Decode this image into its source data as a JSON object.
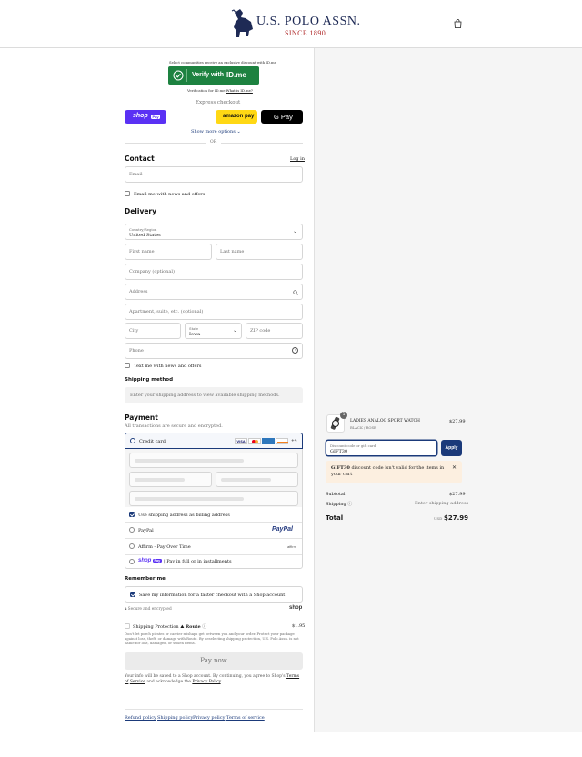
{
  "header": {
    "brand": "U.S. POLO ASSN.",
    "since": "SINCE 1890",
    "cart_icon": "shopping-bag-icon"
  },
  "idme": {
    "promo": "Select communities receive an exclusive discount with ID.me",
    "button_label": "Verify with",
    "button_brand": "ID.me",
    "footnote": "Verification for ID.me",
    "footnote_link": "What is ID.me?"
  },
  "express": {
    "title": "Express checkout",
    "shop_pay": "shop",
    "shop_pay_badge": "Pay",
    "amazon_pay": "amazon pay",
    "google_pay": "G Pay",
    "show_more": "Show more options",
    "or": "OR"
  },
  "contact": {
    "title": "Contact",
    "login": "Log in",
    "email_placeholder": "Email",
    "news_label": "Email me with news and offers"
  },
  "delivery": {
    "title": "Delivery",
    "country_label": "Country/Region",
    "country_value": "United States",
    "first_name": "First name",
    "last_name": "Last name",
    "company": "Company (optional)",
    "address": "Address",
    "apartment": "Apartment, suite, etc. (optional)",
    "city": "City",
    "state_label": "State",
    "state_value": "Iowa",
    "zip": "ZIP code",
    "phone": "Phone",
    "text_label": "Text me with news and offers"
  },
  "shipping": {
    "title": "Shipping method",
    "placeholder": "Enter your shipping address to view available shipping methods."
  },
  "payment": {
    "title": "Payment",
    "subtitle": "All transactions are secure and encrypted.",
    "credit_card": "Credit card",
    "cards": [
      "VISA",
      "MC",
      "AMEX",
      "DISCOVER"
    ],
    "more_cards": "+4",
    "billing_label": "Use shipping address as billing address",
    "paypal": "PayPal",
    "paypal_logo": "PayPal",
    "affirm": "Affirm - Pay Over Time",
    "affirm_logo": "affirm",
    "shoppay_badge": "shop",
    "shoppay_badge_pay": "Pay",
    "shoppay_text": "| Pay in full or in installments"
  },
  "remember": {
    "title": "Remember me",
    "save_label": "Save my information for a faster checkout with a Shop account",
    "secure": "Secure and encrypted",
    "shop_logo": "shop"
  },
  "protection": {
    "label": "Shipping Protection",
    "route": "Route",
    "price": "$1.95",
    "desc_line1": "Don't let porch pirates or carrier mishaps get between you and your order. Protect your package",
    "desc_line2": "against loss, theft, or damage with Route. By deselecting shipping protection, U.S. Polo Assn. is not",
    "desc_line3": "liable for lost, damaged, or stolen items."
  },
  "pay_now": "Pay now",
  "consent": {
    "part1": "Your info will be saved to a Shop account. By continuing, you agree to Shop's",
    "terms": "Terms of",
    "service": "Service",
    "part2": "and acknowledge the",
    "privacy": "Privacy Policy",
    "end": "."
  },
  "footer_links": [
    "Refund policy",
    "Shipping policy",
    "Privacy policy",
    "Terms of service"
  ],
  "summary": {
    "item_qty": "1",
    "item_name": "LADIES ANALOG SPORT WATCH",
    "item_variant": "BLACK / ROSE",
    "item_price": "$27.99",
    "discount_label": "Discount code or gift card",
    "discount_value": "GIFT30",
    "apply": "Apply",
    "error_code": "GIFT30",
    "error_text_1": "discount code isn't valid for the items in your",
    "error_text_2": "cart",
    "subtotal_label": "Subtotal",
    "subtotal_value": "$27.99",
    "shipping_label": "Shipping",
    "shipping_value": "Enter shipping address",
    "total_label": "Total",
    "currency": "USD",
    "total_value": "$27.99"
  },
  "colors": {
    "navy": "#1b3a7a",
    "shop_purple": "#5a31f4",
    "amazon_yellow": "#ffd814",
    "idme_green": "#1d8240",
    "error_bg": "#fcefe0"
  }
}
